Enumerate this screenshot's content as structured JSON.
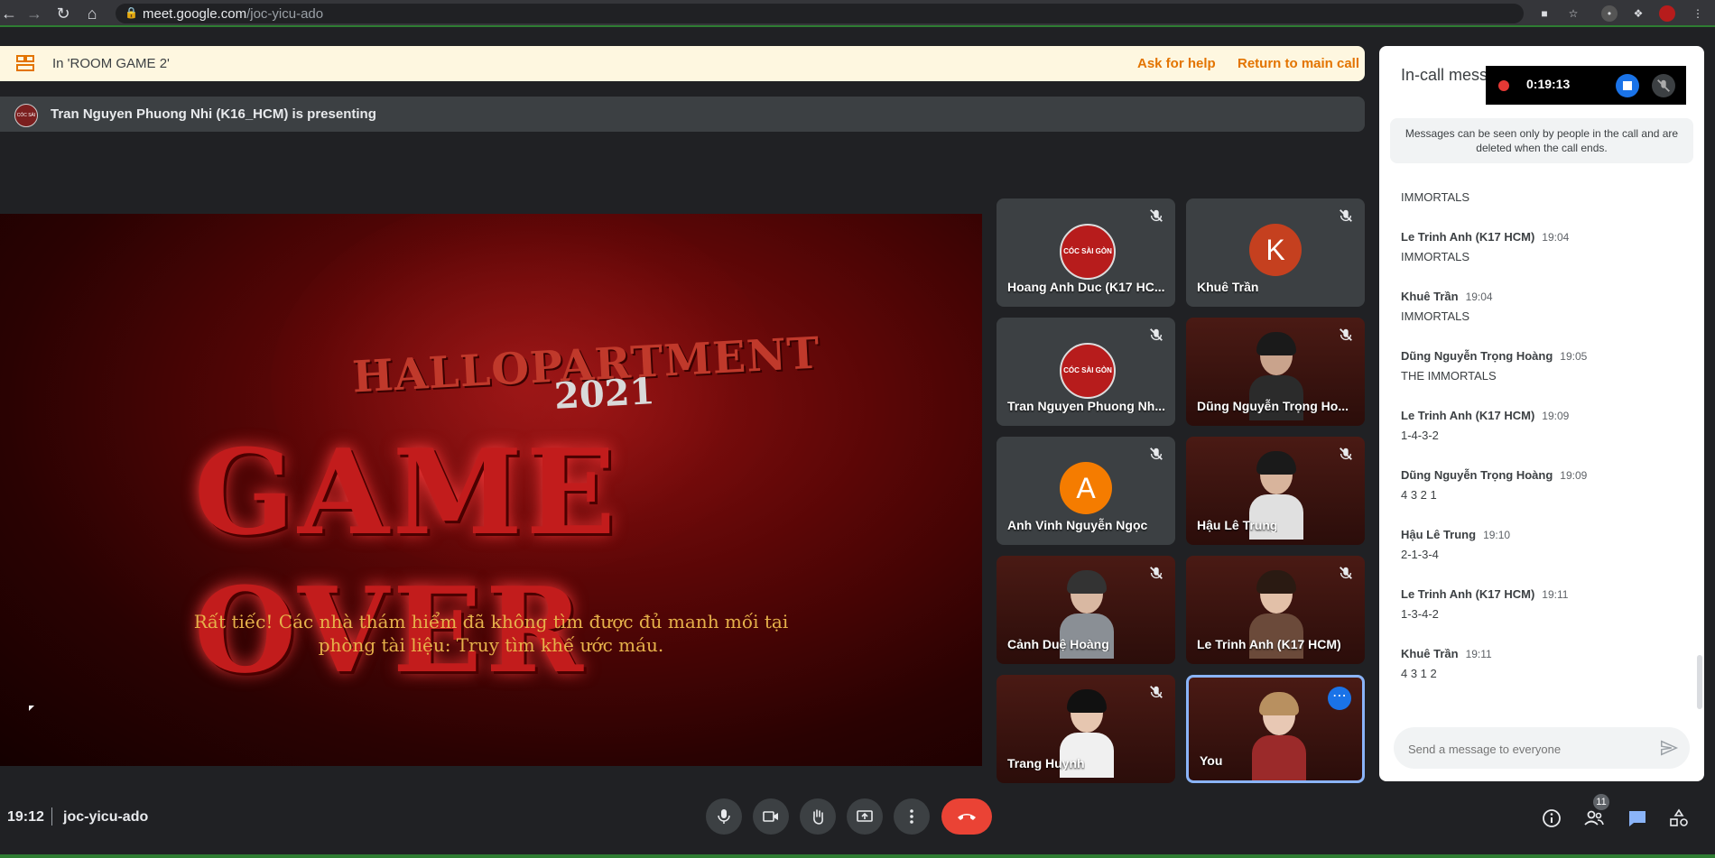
{
  "browser": {
    "url_host": "meet.google.com",
    "url_path": "/joc-yicu-ado"
  },
  "breakout": {
    "room_label": "In 'ROOM GAME 2'",
    "ask_help": "Ask for help",
    "return_main": "Return to main call"
  },
  "presenting": {
    "text": "Tran Nguyen Phuong Nhi (K16_HCM) is presenting",
    "avatar_text": "CÓC SÀI GÒN"
  },
  "stage": {
    "hallo_title": "HALLOPARTMENT",
    "hallo_year": "2021",
    "headline": "GAME OVER",
    "line1": "Rất tiếc! Các nhà thám hiểm đã không tìm được đủ manh mối tại",
    "line2": "phòng tài liệu: Truy tìm khế ước máu."
  },
  "participants": [
    {
      "name": "Hoang Anh Duc (K17 HC...",
      "avatar": "CÓC SÀI GÒN"
    },
    {
      "name": "Khuê Trần",
      "avatar": "K"
    },
    {
      "name": "Tran Nguyen Phuong Nh...",
      "avatar": "CÓC SÀI GÒN"
    },
    {
      "name": "Dũng Nguyễn Trọng Ho..."
    },
    {
      "name": "Anh Vinh Nguyễn Ngọc",
      "avatar": "A"
    },
    {
      "name": "Hậu Lê Trung"
    },
    {
      "name": "Cảnh Duệ Hoàng"
    },
    {
      "name": "Le Trinh Anh (K17 HCM)"
    },
    {
      "name": "Trang Huynh"
    },
    {
      "name": "You"
    }
  ],
  "chat": {
    "title": "In-call mess",
    "notice": "Messages can be seen only by people in the call and are deleted when the call ends.",
    "first_text": "IMMORTALS",
    "messages": [
      {
        "sender": "Le Trinh Anh (K17 HCM)",
        "time": "19:04",
        "text": "IMMORTALS"
      },
      {
        "sender": "Khuê Trần",
        "time": "19:04",
        "text": "IMMORTALS"
      },
      {
        "sender": "Dũng Nguyễn Trọng Hoàng",
        "time": "19:05",
        "text": "THE IMMORTALS"
      },
      {
        "sender": "Le Trinh Anh (K17 HCM)",
        "time": "19:09",
        "text": "1-4-3-2"
      },
      {
        "sender": "Dũng Nguyễn Trọng Hoàng",
        "time": "19:09",
        "text": "4 3 2 1"
      },
      {
        "sender": "Hậu Lê Trung",
        "time": "19:10",
        "text": "2-1-3-4"
      },
      {
        "sender": "Le Trinh Anh (K17 HCM)",
        "time": "19:11",
        "text": "1-3-4-2"
      },
      {
        "sender": "Khuê Trần",
        "time": "19:11",
        "text": "4 3 1 2"
      }
    ],
    "input_placeholder": "Send a message to everyone"
  },
  "recording": {
    "time": "0:19:13"
  },
  "bottom": {
    "clock": "19:12",
    "meeting_code": "joc-yicu-ado",
    "people_count": "11"
  },
  "colors": {
    "accent": "#1a73e8",
    "end_call": "#ea4335",
    "banner_link": "#e37400"
  }
}
